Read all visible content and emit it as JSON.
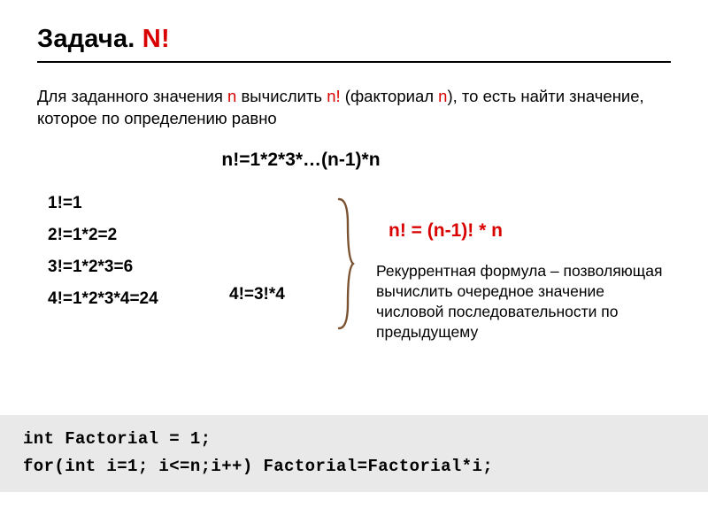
{
  "title": {
    "part1": "Задача. ",
    "part2": "N!"
  },
  "problem": {
    "t1": "Для заданного значения ",
    "n1": "n",
    "t2": " вычислить ",
    "n2": "n!",
    "t3": " (факториал ",
    "n3": "n",
    "t4": "), то есть найти значение, которое по определению равно"
  },
  "formula_center": "n!=1*2*3*…(n-1)*n",
  "left_rows": [
    "1!=1",
    "2!=1*2=2",
    "3!=1*2*3=6",
    "4!=1*2*3*4=24"
  ],
  "mid_text": "4!=3!*4",
  "recurrent_formula": "n! = (n-1)! * n",
  "recurrent_desc": "Рекуррентная формула – позволяющая вычислить очередное значение числовой последовательности по предыдущему",
  "code": {
    "l1": "int Factorial = 1;",
    "l2": "for(int i=1; i<=n;i++) Factorial=Factorial*i;"
  }
}
